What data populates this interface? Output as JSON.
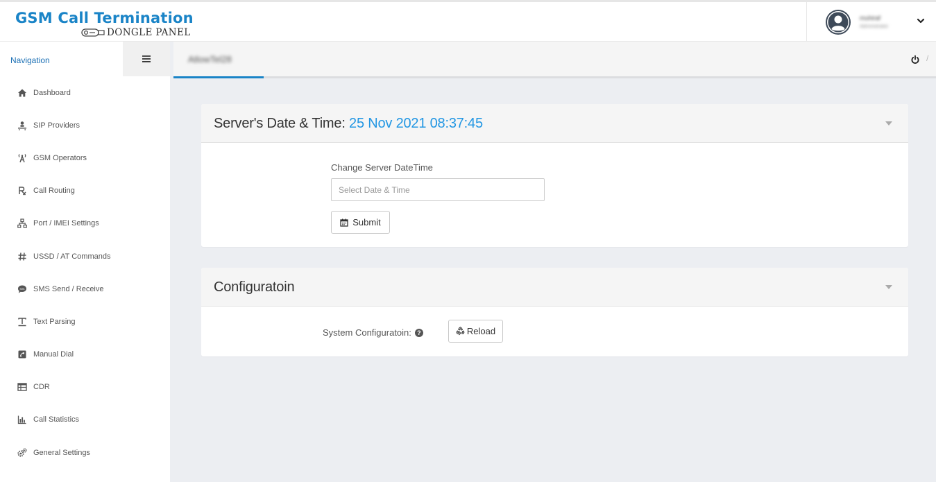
{
  "brand": {
    "title": "GSM Call Termination",
    "subtitle": "DONGLE PANEL"
  },
  "user": {
    "name": "muhiraf",
    "role": "Administrator"
  },
  "sidebar": {
    "title": "Navigation",
    "items": [
      {
        "label": "Dashboard",
        "icon": "home-icon"
      },
      {
        "label": "SIP Providers",
        "icon": "sip-icon"
      },
      {
        "label": "GSM Operators",
        "icon": "antenna-icon"
      },
      {
        "label": "Call Routing",
        "icon": "rx-icon"
      },
      {
        "label": "Port / IMEI Settings",
        "icon": "network-icon"
      },
      {
        "label": "USSD / AT Commands",
        "icon": "hash-icon"
      },
      {
        "label": "SMS Send / Receive",
        "icon": "sms-icon"
      },
      {
        "label": "Text Parsing",
        "icon": "text-icon"
      },
      {
        "label": "Manual Dial",
        "icon": "dial-icon"
      },
      {
        "label": "CDR",
        "icon": "table-icon"
      },
      {
        "label": "Call Statistics",
        "icon": "bar-chart-icon"
      },
      {
        "label": "General Settings",
        "icon": "gears-icon"
      }
    ]
  },
  "tabs": {
    "active_label": "AtlowTel28",
    "separator": "/"
  },
  "server_card": {
    "title": "Server's Date & Time: ",
    "datetime": "25 Nov 2021 08:37:45",
    "field_label": "Change Server DateTime",
    "input_placeholder": "Select Date & Time",
    "submit_label": "Submit"
  },
  "config_card": {
    "title": "Configuratoin",
    "system_label": "System Configuratoin:",
    "reload_label": "Reload"
  },
  "colors": {
    "accent": "#1a84c7",
    "datetime": "#2196e3"
  }
}
